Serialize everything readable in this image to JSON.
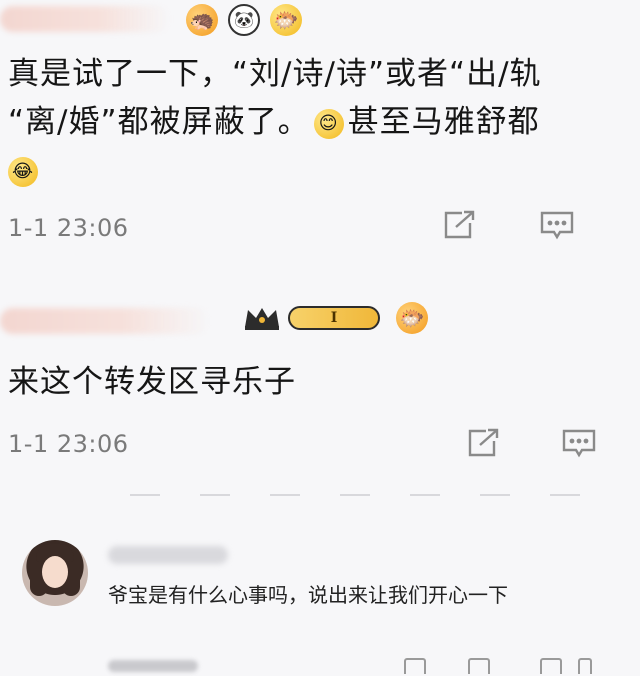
{
  "colors": {
    "background": "#f7f7f9",
    "text": "#161616",
    "meta": "#7a7a7a",
    "badge": "#f0b739"
  },
  "comments": [
    {
      "emojis": [
        "hedgehog-emoji",
        "panda-emoji",
        "fish-emoji"
      ],
      "text_line1": "真是试了一下，“刘/诗/诗”或者“出/轨",
      "text_line2": "“离/婚”都被屏蔽了。",
      "text_line2_tail": "甚至马雅舒都",
      "time": "1-1 23:06"
    },
    {
      "badge_label": "I",
      "text": "来这个转发区寻乐子",
      "time": "1-1 23:06"
    }
  ],
  "reply": {
    "text": "爷宝是有什么心事吗，说出来让我们开心一下"
  }
}
